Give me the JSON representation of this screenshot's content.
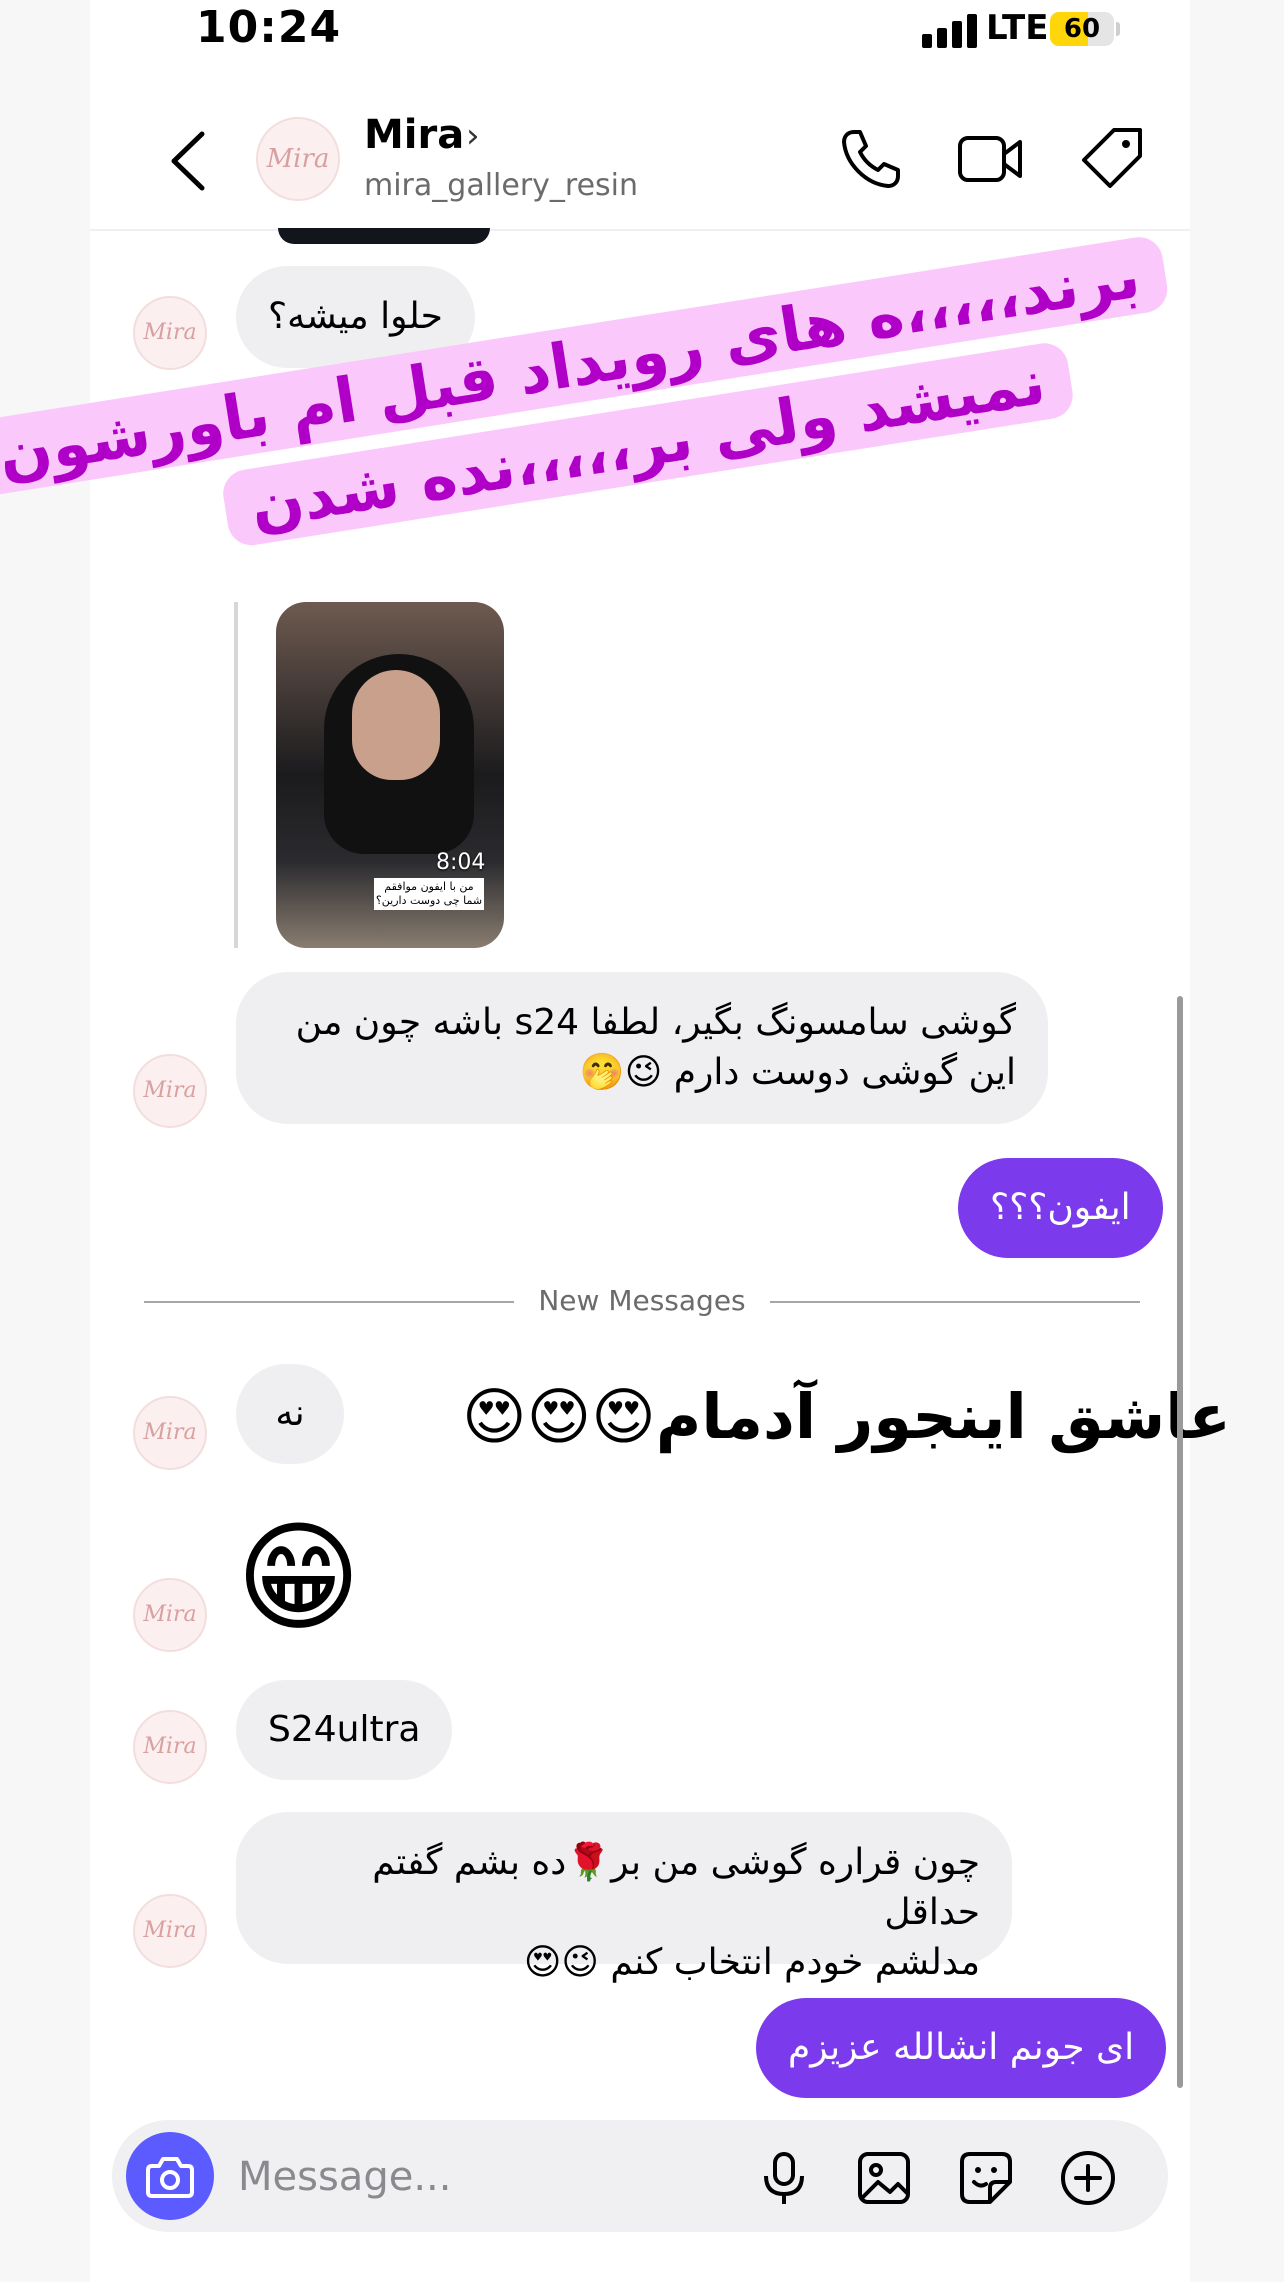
{
  "status_bar": {
    "time": "10:24",
    "network": "LTE",
    "battery": "60",
    "battery_level": 0.6
  },
  "header": {
    "avatar_text": "Mira",
    "contact_name": "Mira",
    "username": "mira_gallery_resin"
  },
  "icons": {
    "back": "chevron-left-icon",
    "call": "phone-icon",
    "video": "video-icon",
    "tag": "tag-icon",
    "camera": "camera-icon",
    "mic": "microphone-icon",
    "gallery": "image-icon",
    "sticker": "sticker-icon",
    "add": "plus-circle-icon"
  },
  "sticker_overlay": {
    "line1": "برند،،،،،ه های رویداد قبل ام باورشون",
    "line2": "نمیشد ولی بر،،،،،نده شدن"
  },
  "photo_message": {
    "time": "8:04",
    "caption": "من با ایفون موافقم شما چی دوست دارین؟"
  },
  "messages": {
    "m1": "حلوا میشه؟",
    "m2_line1": "گوشی سامسونگ بگیر، لطفا s24 باشه چون من",
    "m2_line2": "این گوشی دوست دارم 😉🤭",
    "m3": "ایفون؟؟؟",
    "m4": "نه",
    "m5": "😁",
    "m6": "S24ultra",
    "m7_line1": "چون قراره گوشی من بر🌹ده بشم گفتم حداقل",
    "m7_line2": "مدلشم خودم انتخاب کنم 😉😍",
    "m8": "ای جونم انشالله عزیزم"
  },
  "divider": "New Messages",
  "overlay_caption": "عاشق اینجور آدمام😍😍😍",
  "composer": {
    "placeholder": "Message..."
  },
  "colors": {
    "outgoing_bubble": "#7c3aed",
    "incoming_bubble": "#efeff1",
    "camera_button": "#5b5bff",
    "sticker_bg": "#fbc8fb",
    "sticker_text": "#b000c8"
  }
}
